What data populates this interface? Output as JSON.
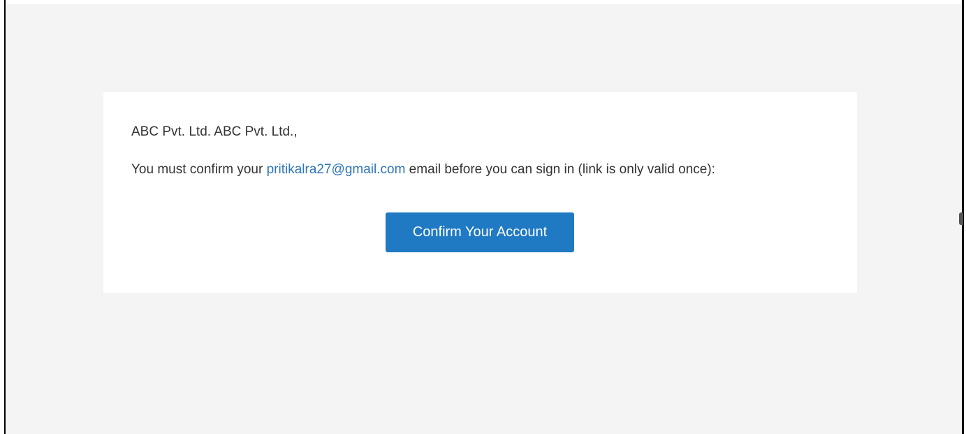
{
  "email": {
    "greeting": "ABC Pvt. Ltd. ABC Pvt. Ltd.,",
    "message_before": "You must confirm your ",
    "email_address": "pritikalra27@gmail.com",
    "message_after": " email before you can sign in (link is only valid once):",
    "button_label": "Confirm Your Account"
  },
  "colors": {
    "canvas_background": "#f4f4f4",
    "card_background": "#ffffff",
    "text": "#333333",
    "link": "#2f76b6",
    "button": "#1f79c3",
    "button_text": "#ffffff"
  }
}
